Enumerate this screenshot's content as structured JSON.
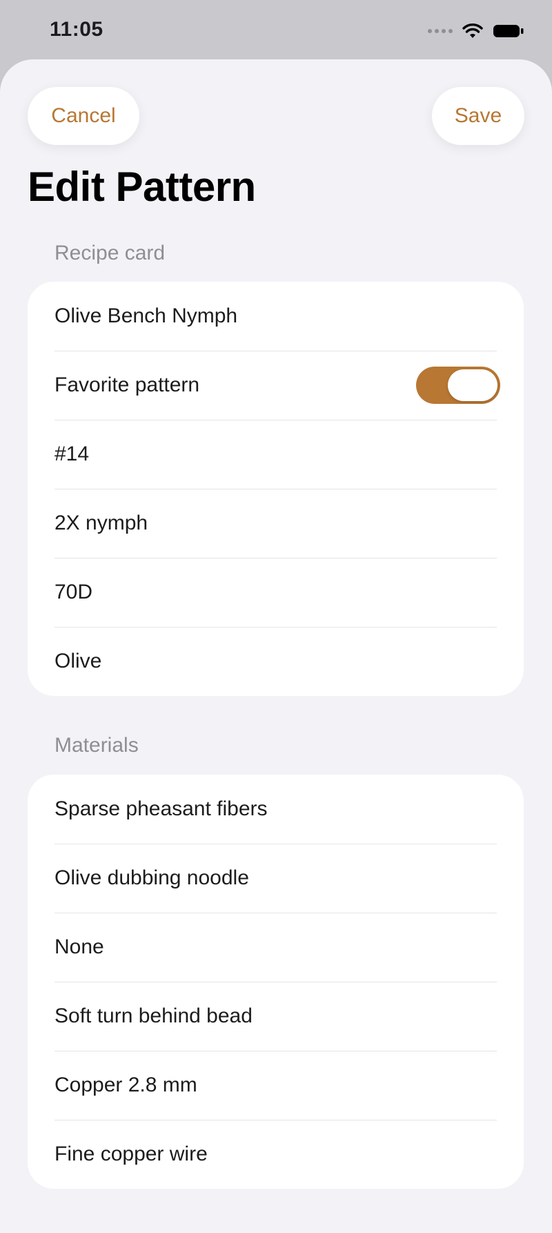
{
  "status_bar": {
    "time": "11:05"
  },
  "nav": {
    "cancel_label": "Cancel",
    "save_label": "Save",
    "title": "Edit Pattern"
  },
  "colors": {
    "accent": "#b87733",
    "background": "#f2f2f7",
    "card": "#ffffff",
    "section_header": "#8e8e93"
  },
  "recipe_card": {
    "header": "Recipe card",
    "name": "Olive Bench Nymph",
    "favorite_label": "Favorite pattern",
    "favorite_on": true,
    "hook_size": "#14",
    "hook_type": "2X nymph",
    "thread": "70D",
    "color": "Olive"
  },
  "materials": {
    "header": "Materials",
    "items": [
      "Sparse pheasant fibers",
      "Olive dubbing noodle",
      "None",
      "Soft turn behind bead",
      "Copper 2.8 mm",
      "Fine copper wire"
    ]
  }
}
